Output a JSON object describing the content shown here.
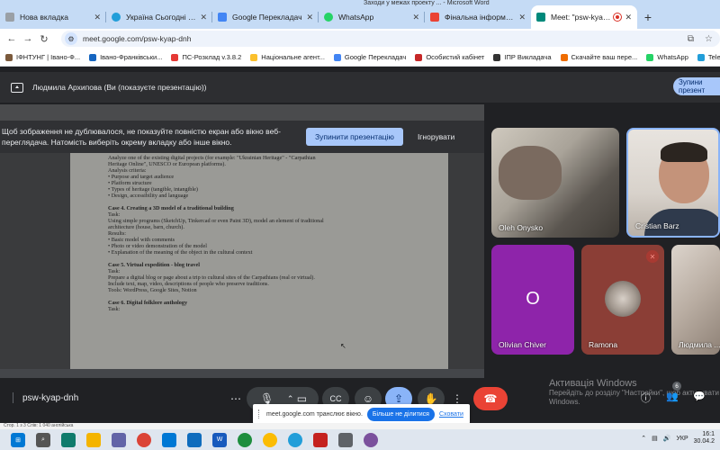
{
  "window_title": "Заходи у межах проекту ... - Microsoft Word",
  "tabs": [
    {
      "label": "Нова вкладка",
      "color": "#9aa0a6"
    },
    {
      "label": "Україна Сьогодні | Новини",
      "color": "#229ed9"
    },
    {
      "label": "Google Перекладач",
      "color": "#4285f4"
    },
    {
      "label": "WhatsApp",
      "color": "#25d366"
    },
    {
      "label": "Фінальна інформація для",
      "color": "#ea4335"
    },
    {
      "label": "Meet: \"psw-kyap-dnh\"",
      "color": "#00897b"
    }
  ],
  "address": {
    "url": "meet.google.com/psw-kyap-dnh"
  },
  "bookmarks": [
    {
      "label": "ІФНТУНГ | Івано-Ф...",
      "color": "#7b5a3c"
    },
    {
      "label": "Івано-Франківськи...",
      "color": "#1565c0"
    },
    {
      "label": "ПС-Розклад v.3.8.2",
      "color": "#e53935"
    },
    {
      "label": "Національне агент...",
      "color": "#fbc02d"
    },
    {
      "label": "Google Перекладач",
      "color": "#4285f4"
    },
    {
      "label": "Особистий кабінет",
      "color": "#c62828"
    },
    {
      "label": "ІПР Викладача",
      "color": "#333333"
    },
    {
      "label": "Скачайте ваш пере...",
      "color": "#ef6c00"
    },
    {
      "label": "WhatsApp",
      "color": "#25d366"
    },
    {
      "label": "Telegram",
      "color": "#229ed9"
    }
  ],
  "presenting": {
    "text": "Людмила Архипова (Ви (показуєте презентацію))",
    "stop_label": "Зупини презент"
  },
  "warning": {
    "text": "Щоб зображення не дублювалося, не показуйте повністю екран або вікно веб-переглядача. Натомість виберіть окрему вкладку або інше вікно.",
    "stop_label": "Зупинити презентацію",
    "ignore_label": "Ігнорувати"
  },
  "document": {
    "lines": [
      {
        "t": "Analyze one of the existing digital projects (for example: \"Ukrainian Heritage\" - \"Carpathian",
        "b": false
      },
      {
        "t": "Heritage Online\", UNESCO or European platforms).",
        "b": false
      },
      {
        "t": "Analysis criteria:",
        "b": false
      },
      {
        "t": "• Purpose and target audience",
        "b": false
      },
      {
        "t": "• Platform structure",
        "b": false
      },
      {
        "t": "• Types of heritage (tangible, intangible)",
        "b": false
      },
      {
        "t": "• Design, accessibility and language",
        "b": false
      },
      {
        "t": "",
        "b": false
      },
      {
        "t": "Case 4. Creating a 3D model of a traditional building",
        "b": true
      },
      {
        "t": "Task:",
        "b": false
      },
      {
        "t": "Using simple programs (SketchUp, Tinkercad or even Paint 3D), model an element of traditional",
        "b": false
      },
      {
        "t": "architecture (house, barn, church).",
        "b": false
      },
      {
        "t": "Results:",
        "b": false
      },
      {
        "t": "• Basic model with comments",
        "b": false
      },
      {
        "t": "• Photo or video demonstration of the model",
        "b": false
      },
      {
        "t": "• Explanation of the meaning of the object in the cultural context",
        "b": false
      },
      {
        "t": "",
        "b": false
      },
      {
        "t": "Case 5. Virtual expedition - blog travel",
        "b": true
      },
      {
        "t": "Task:",
        "b": false
      },
      {
        "t": "Prepare a digital blog or page about a trip to cultural sites of the Carpathians (real or virtual).",
        "b": false
      },
      {
        "t": "Include text, map, video, descriptions of people who preserve traditions.",
        "b": false
      },
      {
        "t": "Tools: WordPress, Google Sites, Notion",
        "b": false
      },
      {
        "t": "",
        "b": false
      },
      {
        "t": "Case 6. Digital folklore anthology",
        "b": true
      },
      {
        "t": "Task:",
        "b": false
      }
    ]
  },
  "participants": [
    {
      "name": "Oleh Onysko"
    },
    {
      "name": "Cristian Barz"
    },
    {
      "name": "Olivian Chiver",
      "initial": "O",
      "color": "#8e24aa"
    },
    {
      "name": "Ramona"
    },
    {
      "name": "Людмила ..."
    }
  ],
  "watermark": {
    "title": "Активація Windows",
    "subtitle": "Перейдіть до розділу \"Настройки\", щоб активувати Windows."
  },
  "meeting": {
    "code": "psw-kyap-dnh",
    "participant_count": "6"
  },
  "share_notice": {
    "text": "meet.google.com транслює вікно.",
    "stop_label": "Більше не ділитися",
    "hide_label": "Сховати"
  },
  "word_status": "Стор. 1 з 3   Слів: 1 040   англійська",
  "taskbar": {
    "lang": "УКР",
    "time": "16:1",
    "date": "30.04.2"
  }
}
